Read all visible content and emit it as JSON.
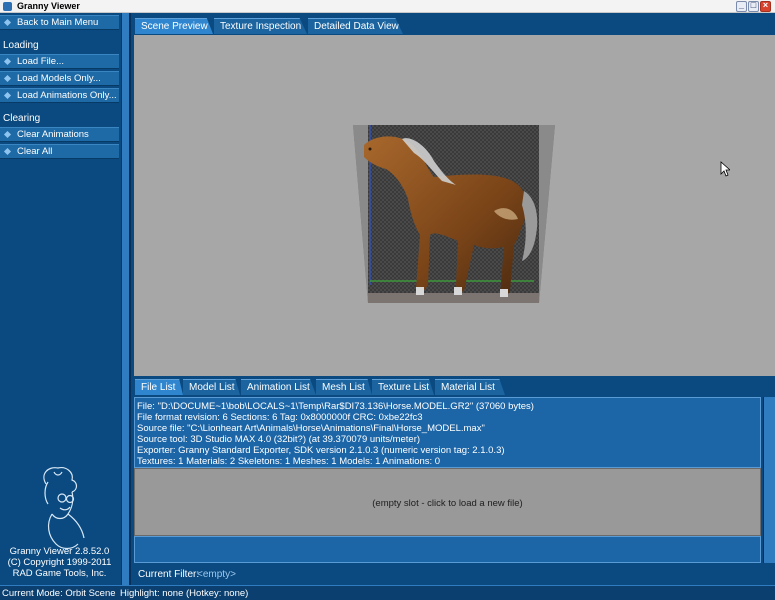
{
  "window": {
    "title": "Granny Viewer"
  },
  "sidebar": {
    "back_label": "Back to Main Menu",
    "loading_header": "Loading",
    "loading_items": [
      "Load File...",
      "Load Models Only...",
      "Load Animations Only..."
    ],
    "clearing_header": "Clearing",
    "clearing_items": [
      "Clear Animations",
      "Clear All"
    ],
    "credits": [
      "Granny Viewer 2.8.52.0",
      "(C) Copyright 1999-2011",
      "RAD Game Tools, Inc."
    ]
  },
  "top_tabs": [
    "Scene Preview",
    "Texture Inspection",
    "Detailed Data View"
  ],
  "top_tabs_active": "Scene Preview",
  "bottom_tabs": [
    "File List",
    "Model List",
    "Animation List",
    "Mesh List",
    "Texture List",
    "Material List"
  ],
  "bottom_tabs_active": "File List",
  "file_info": {
    "lines": [
      "File: \"D:\\DOCUME~1\\bob\\LOCALS~1\\Temp\\Rar$DI73.136\\Horse.MODEL.GR2\" (37060 bytes)",
      "File format revision: 6    Sections: 6    Tag: 0x8000000f    CRC: 0xbe22fc3",
      "Source file: \"C:\\Lionheart Art\\Animals\\Horse\\Animations\\Final\\Horse_MODEL.max\"",
      "Source tool: 3D Studio MAX 4.0 (32bit?) (at 39.370079 units/meter)",
      "Exporter: Granny Standard Exporter, SDK version 2.1.0.3 (numeric version tag: 2.1.0.3)",
      "Textures: 1     Materials: 2     Skeletons: 1     Meshes: 1     Models: 1     Animations: 0"
    ]
  },
  "empty_slot_text": "(empty slot - click to load a new file)",
  "filter": {
    "label": "Current Filter:",
    "value": "<empty>"
  },
  "status": {
    "mode": "Current Mode: Orbit Scene",
    "highlight": "Highlight: none (Hotkey: none)"
  },
  "colors": {
    "panel_blue": "#0a4a80",
    "tab_blue": "#1b64a0",
    "viewport_gray": "#a7a7a7"
  }
}
